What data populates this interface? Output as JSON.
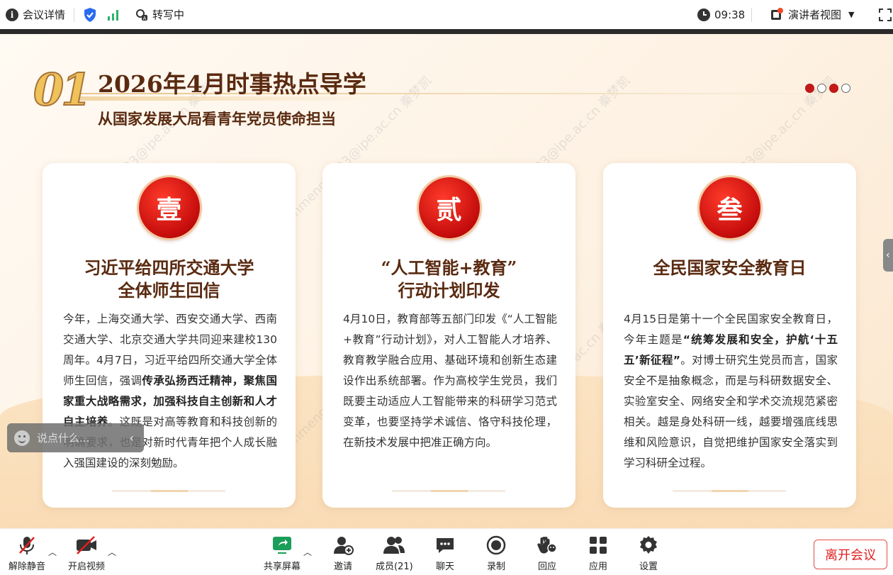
{
  "topbar": {
    "meeting_details": "会议详情",
    "transcribe": "转写中",
    "time": "09:38",
    "view_mode": "演讲者视图"
  },
  "slide": {
    "section_number": "01",
    "title": "2026年4月时事热点导学",
    "subtitle": "从国家发展大局看青年党员使命担当",
    "watermark": "qinmengkai23@ipe.ac.cn 秦梦凯",
    "cards": [
      {
        "badge": "壹",
        "title_lines": [
          "习近平给四所交通大学",
          "全体师生回信"
        ],
        "body": [
          {
            "t": "今年，上海交通大学、西安交通大学、西南交通大学、北京交通大学共同迎来建校130周年。4月7日，习近平给四所交通大学全体师生回信，强调",
            "b": false
          },
          {
            "t": "传承弘扬西迁精神，聚焦国家重大战略需求，加强科技自主创新和人才自主培养",
            "b": true
          },
          {
            "t": "。这既是对高等教育和科技创新的明确要求，也是对新时代青年把个人成长融入强国建设的深刻勉励。",
            "b": false
          }
        ]
      },
      {
        "badge": "贰",
        "title_lines": [
          "“人工智能+教育”",
          "行动计划印发"
        ],
        "body": [
          {
            "t": "4月10日，教育部等五部门印发《“人工智能+教育”行动计划》，对人工智能人才培养、教育教学融合应用、基础环境和创新生态建设作出系统部署。作为高校学生党员，我们既要主动适应人工智能带来的科研学习范式变革，也要坚持学术诚信、恪守科技伦理，在新技术发展中把准正确方向。",
            "b": false
          }
        ]
      },
      {
        "badge": "叁",
        "title_lines": [
          "全民国家安全教育日"
        ],
        "body": [
          {
            "t": "4月15日是第十一个全民国家安全教育日，今年主题是",
            "b": false
          },
          {
            "t": "“统筹发展和安全，护航‘十五五’新征程”",
            "b": true
          },
          {
            "t": "。对博士研究生党员而言，国家安全不是抽象概念，而是与科研数据安全、实验室安全、网络安全和学术交流规范紧密相关。越是身处科研一线，越要增强底线思维和风险意识，自觉把维护国家安全落实到学习科研全过程。",
            "b": false
          }
        ]
      }
    ]
  },
  "chat": {
    "placeholder": "说点什么..."
  },
  "toolbar": {
    "unmute": "解除静音",
    "start_video": "开启视频",
    "share_screen": "共享屏幕",
    "invite": "邀请",
    "members": "成员(21)",
    "chat": "聊天",
    "record": "录制",
    "reactions": "回应",
    "apps": "应用",
    "settings": "设置",
    "leave": "离开会议"
  },
  "colors": {
    "accent_red": "#c41818",
    "title_brown": "#5a2a10",
    "leave_red": "#e02020",
    "share_green": "#1a9e5a"
  }
}
